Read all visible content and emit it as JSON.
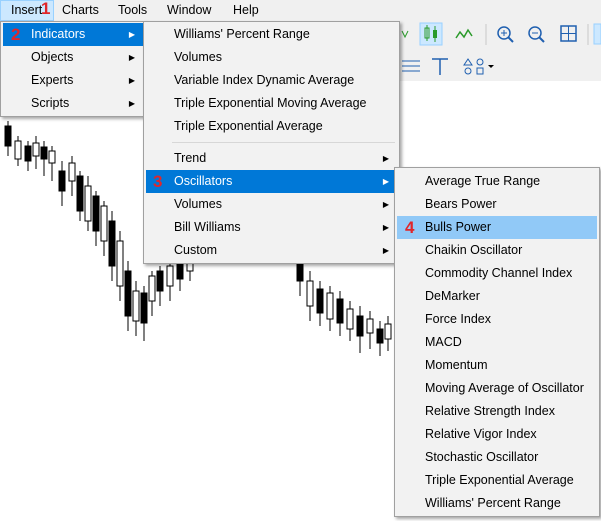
{
  "menubar": {
    "insert": "Insert",
    "charts": "Charts",
    "tools": "Tools",
    "window": "Window",
    "help": "Help"
  },
  "badges": {
    "b1": "1",
    "b2": "2",
    "b3": "3",
    "b4": "4"
  },
  "insert_menu": [
    "Indicators",
    "Objects",
    "Experts",
    "Scripts"
  ],
  "indicators_menu": {
    "top": [
      "Williams' Percent Range",
      "Volumes",
      "Variable Index Dynamic Average",
      "Triple Exponential Moving Average",
      "Triple Exponential Average"
    ],
    "groups": [
      "Trend",
      "Oscillators",
      "Volumes",
      "Bill Williams",
      "Custom"
    ]
  },
  "oscillators_menu": [
    "Average True Range",
    "Bears Power",
    "Bulls Power",
    "Chaikin Oscillator",
    "Commodity Channel Index",
    "DeMarker",
    "Force Index",
    "MACD",
    "Momentum",
    "Moving Average of Oscillator",
    "Relative Strength Index",
    "Relative Vigor Index",
    "Stochastic Oscillator",
    "Triple Exponential Average",
    "Williams' Percent Range"
  ],
  "colors": {
    "highlight": "#0078d7",
    "badge": "#e0262b",
    "menu_bg": "#f2f2f2"
  }
}
